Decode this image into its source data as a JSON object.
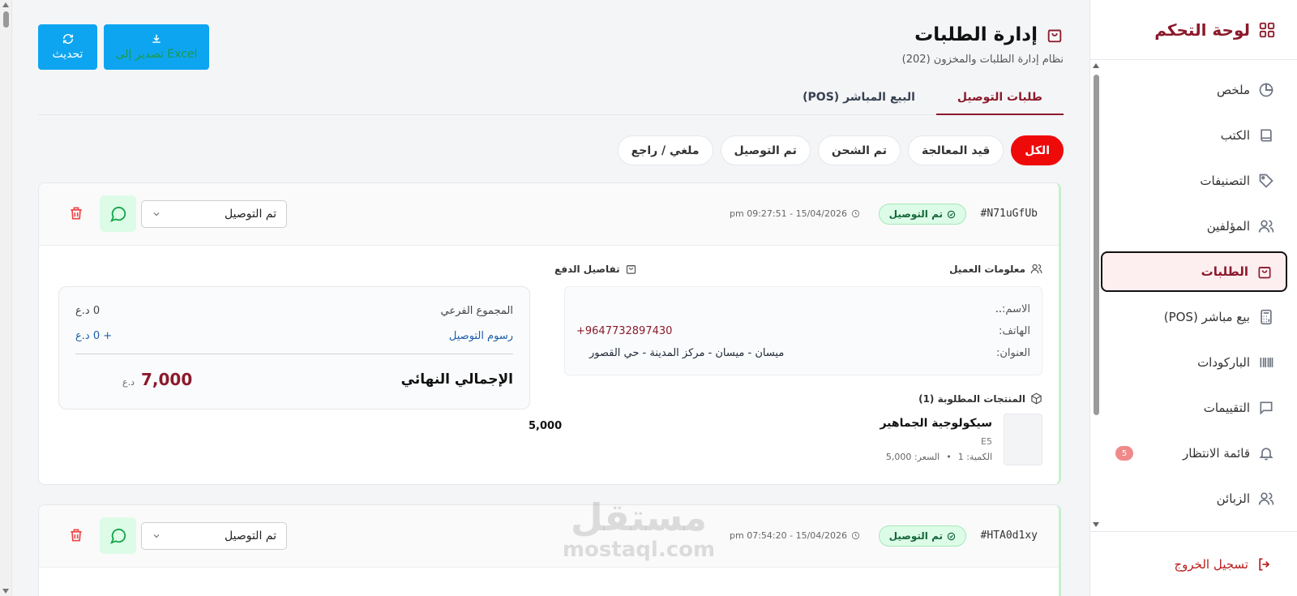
{
  "sidebar": {
    "title": "لوحة التحكم",
    "items": [
      {
        "label": "ملخص",
        "icon": "pie-chart-icon"
      },
      {
        "label": "الكتب",
        "icon": "book-icon"
      },
      {
        "label": "التصنيفات",
        "icon": "tag-icon"
      },
      {
        "label": "المؤلفين",
        "icon": "users-icon"
      },
      {
        "label": "الطلبات",
        "icon": "shopping-bag-icon",
        "active": true
      },
      {
        "label": "بيع مباشر (POS)",
        "icon": "calculator-icon"
      },
      {
        "label": "الباركودات",
        "icon": "barcode-icon"
      },
      {
        "label": "التقييمات",
        "icon": "message-icon"
      },
      {
        "label": "قائمة الانتظار",
        "icon": "bell-icon",
        "badge": "5"
      },
      {
        "label": "الزبائن",
        "icon": "users-icon"
      }
    ],
    "logout": "تسجيل الخروج"
  },
  "header": {
    "title": "إدارة الطلبات",
    "subtitle": "نظام إدارة الطلبات والمخزون (202)",
    "refresh_label": "تحديث",
    "excel_label": "تصدير إلى Excel"
  },
  "tabs": [
    "طلبات التوصيل",
    "البيع المباشر (POS)"
  ],
  "filters": [
    "الكل",
    "قيد المعالجة",
    "تم الشحن",
    "تم التوصيل",
    "ملغي / راجع"
  ],
  "orders": [
    {
      "id": "#N71uGfUb",
      "status": "تم التوصيل",
      "time": "pm 09:27:51 - 15/04/2026",
      "select_value": "تم التوصيل",
      "customer_title": "معلومات العميل",
      "name_label": "الاسم:",
      "name": "..",
      "phone_label": "الهاتف:",
      "phone": "+9647732897430",
      "address_label": "العنوان:",
      "address": "ميسان - ميسان - مركز المدينة - حي القصور",
      "payment_title": "تفاصيل الدفع",
      "subtotal_label": "المجموع الفرعي",
      "subtotal": "0 د.ع",
      "delivery_label": "رسوم التوصيل",
      "delivery": "+ 0 د.ع",
      "total_label": "الإجمالي النهائي",
      "total": "7,000",
      "currency": "د.ع",
      "products_title": "المنتجات المطلوبة (1)",
      "product_name": "سيكولوجية الجماهير",
      "product_code": "E5",
      "product_qty": "الكمية: 1",
      "product_price": "السعر: 5,000",
      "product_total": "5,000"
    },
    {
      "id": "#HTA0d1xy",
      "status": "تم التوصيل",
      "time": "pm 07:54:20 - 15/04/2026",
      "select_value": "تم التوصيل"
    }
  ],
  "watermark": {
    "ar": "مستقل",
    "en": "mostaql.com"
  },
  "colors": {
    "brand": "#8b1a2b",
    "primary_button": "#0ea5f0",
    "filter_active": "#ef0a0a",
    "status_green": "#14663a"
  }
}
